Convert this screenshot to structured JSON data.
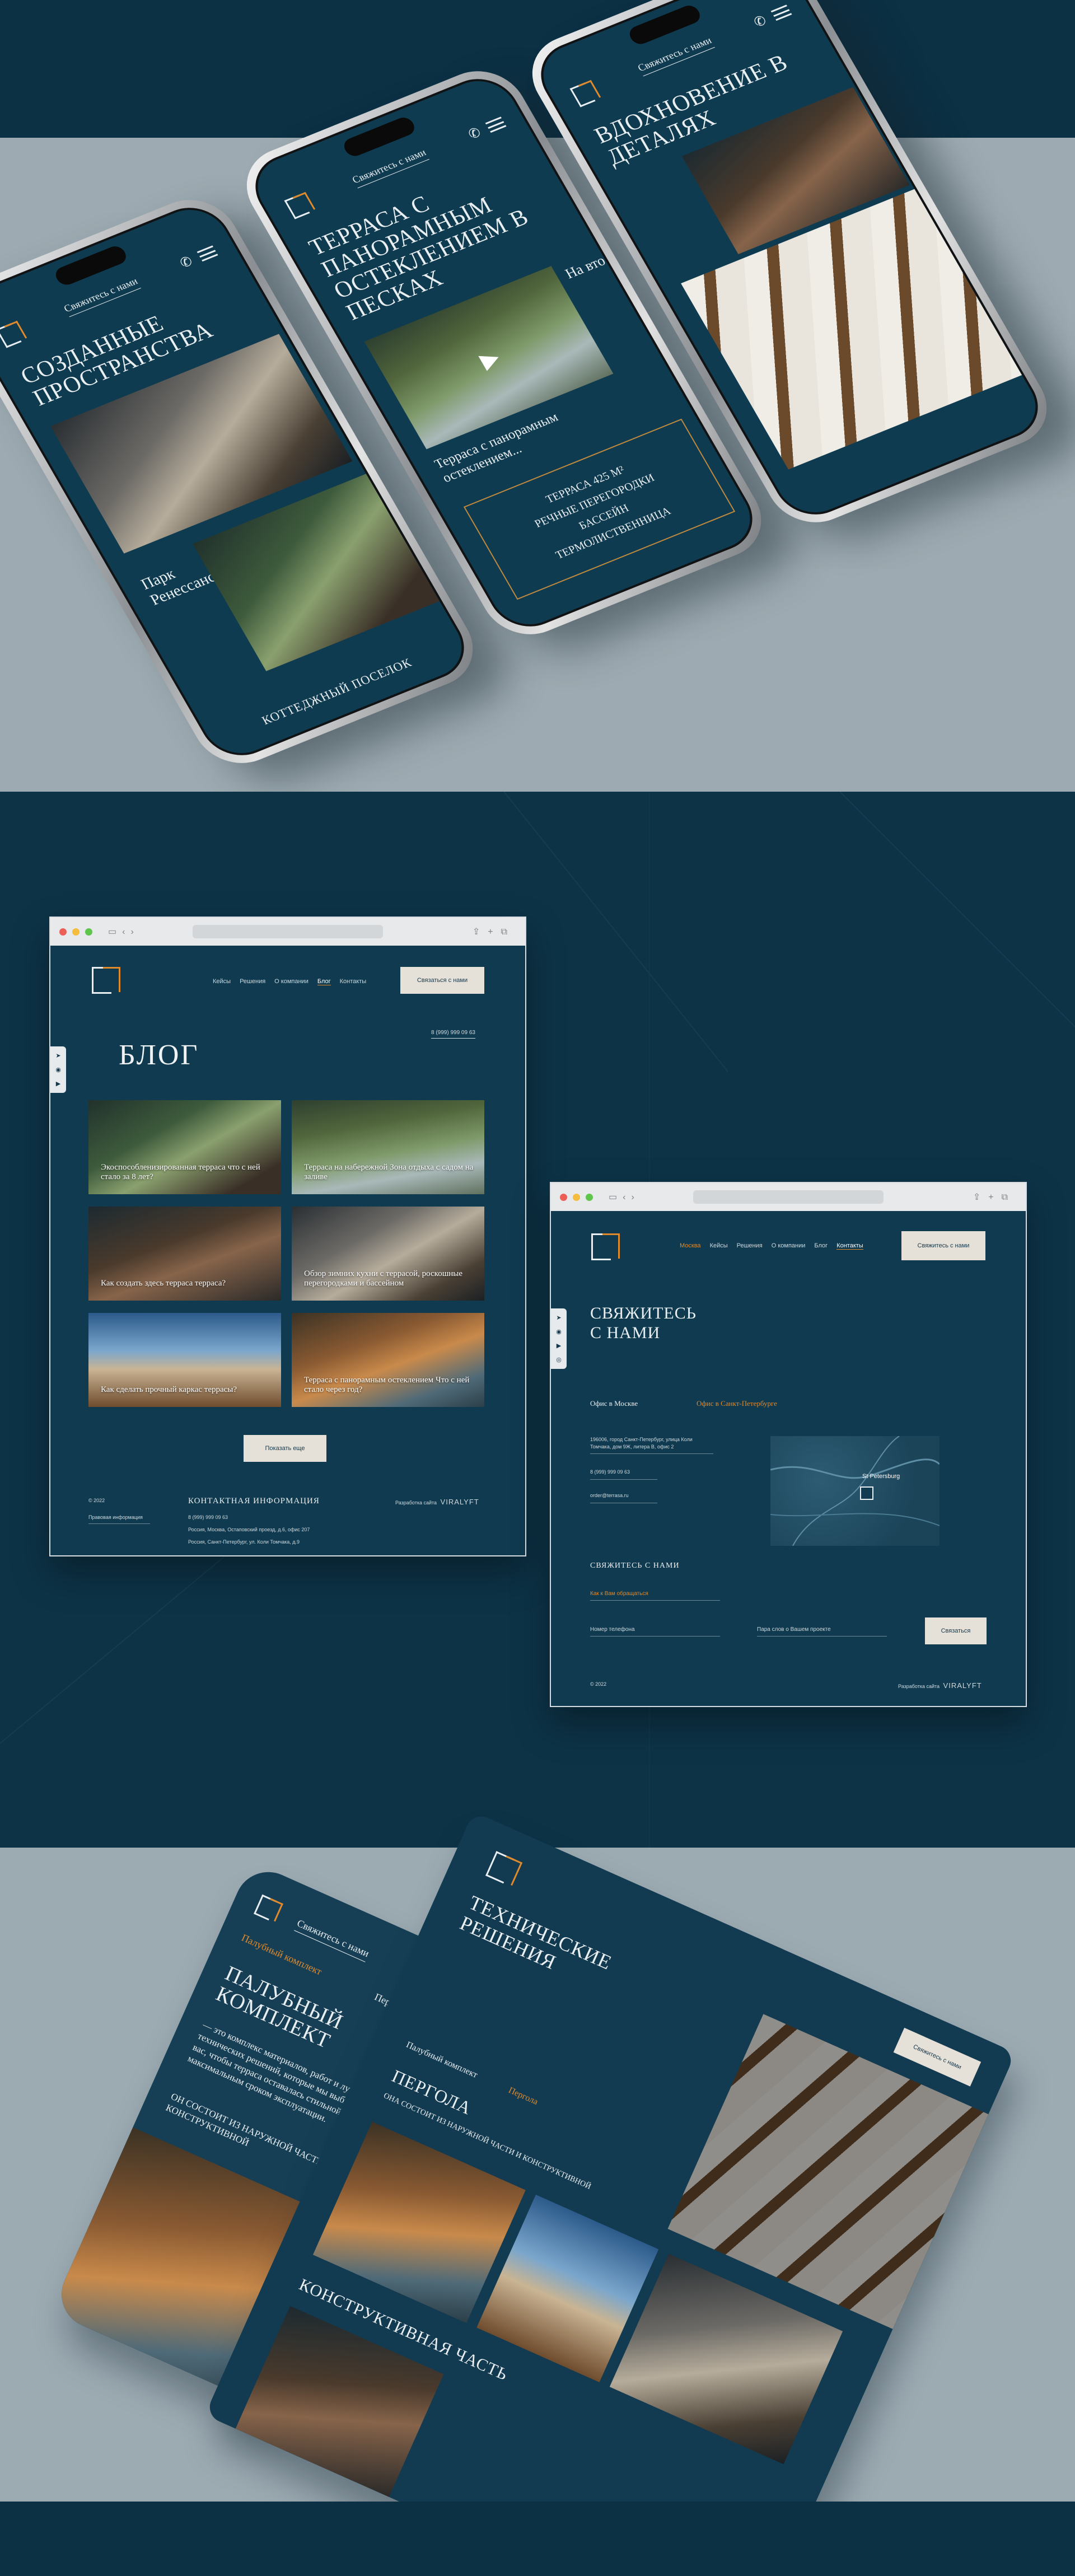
{
  "phones": {
    "cta": "Свяжитесь с нами",
    "phone1": {
      "title": "Созданные пространства",
      "caption": "Парк Ренессанс",
      "footer": "Коттеджный поселок"
    },
    "phone2": {
      "title": "Терраса с панорамным остеклением в песках",
      "caption": "Терраса с панорамным остеклением...",
      "peek": "На вто",
      "specs": [
        "Терраса 425 м²",
        "Речные перегородки",
        "Бассейн",
        "Термолиственница"
      ]
    },
    "phone3": {
      "title": "Вдохновение в деталях"
    }
  },
  "blog_site": {
    "nav": [
      "Кейсы",
      "Решения",
      "О компании",
      "Блог",
      "Контакты"
    ],
    "active_nav": "Блог",
    "cta_button": "Связаться с нами",
    "phone": "8 (999) 999 09 63",
    "title": "БЛОГ",
    "cards": [
      "Экоспособленизированная терраса что с ней стало за 8 лет?",
      "Терраса на набережной Зона отдыха с садом на заливе",
      "Как создать здесь терраса терраса?",
      "Обзор зимних кухни с террасой, роскошные перегородками и бассейном",
      "Как сделать прочный каркас террасы?",
      "Терраса с панорамным остеклением Что с ней стало через год?"
    ],
    "more_button": "Показать еще",
    "footer": {
      "copyright": "© 2022",
      "privacy": "Правовая информация",
      "contacts_head": "КОНТАКТНАЯ ИНФОРМАЦИЯ",
      "contact_lines": [
        "8 (999) 999 09 63",
        "Россия, Москва, Остаповский проезд, д.6, офис 207",
        "Россия, Санкт-Петербург, ул. Коли Томчака, д.9"
      ],
      "dev_label": "Разработка сайта",
      "dev_brand": "VIRALYFT"
    }
  },
  "contacts_site": {
    "nav": [
      "Москва",
      "Кейсы",
      "Решения",
      "О компании",
      "Блог",
      "Контакты"
    ],
    "active_nav": "Контакты",
    "cta_button": "Свяжитесь с нами",
    "title_line1": "СВЯЖИТЕСЬ",
    "title_line2": "С НАМИ",
    "tab_moscow": "Офис в Москве",
    "tab_spb": "Офис в Санкт-Петербурге",
    "address": "196006, город Санкт-Петербург, улица Коли Томчака, дом 9Ж, литера В, офис 2",
    "phone": "8 (999) 999 09 63",
    "email": "order@terrasa.ru",
    "map_label": "St Petersburg",
    "form_head": "СВЯЖИТЕСЬ С НАМИ",
    "field_name": "Как к Вам обращаться",
    "field_phone": "Номер телефона",
    "field_msg": "Пара слов о Вашем проекте",
    "submit": "Связаться",
    "copyright": "© 2022",
    "dev_label": "Разработка сайта",
    "dev_brand": "VIRALYFT"
  },
  "bottom_phone": {
    "cta": "Свяжитесь с нами",
    "breadcrumb_left": "Палубный комплект",
    "breadcrumb_right": "Пергола",
    "title": "Палубный комплект",
    "body": "— это комплекс материалов, работ и лучших технических решений, которые мы выбираем для вас, чтобы терраса оставалась стильной и с максимальным сроком эксплуатации.",
    "body2": "Он состоит из наружной части и конструктивной"
  },
  "bottom_site": {
    "title": "Технические решения",
    "tab1": "Палубный комплект",
    "tab2": "Пергола",
    "section_title": "Пергола",
    "section_sub": "Она состоит из наружной части и конструктивной",
    "section2": "Конструктивная часть",
    "cta": "Свяжитесь с нами"
  }
}
